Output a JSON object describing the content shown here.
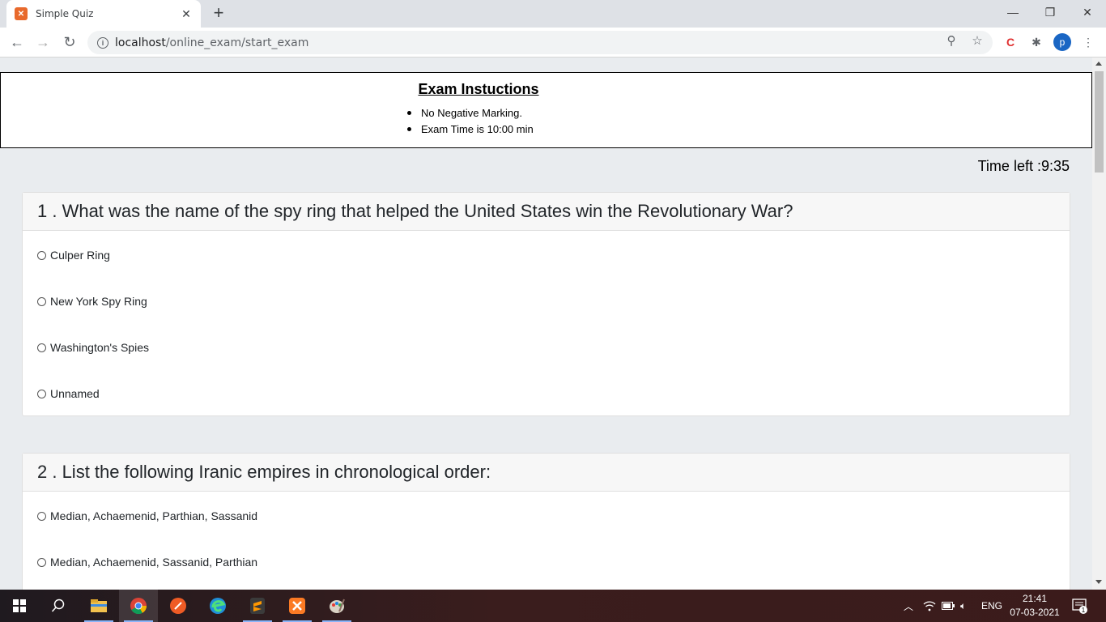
{
  "browser": {
    "tab_title": "Simple Quiz",
    "url_host": "localhost",
    "url_path": "/online_exam/start_exam",
    "avatar_letter": "p"
  },
  "instructions": {
    "heading": "Exam Instuctions",
    "items": [
      "No Negative Marking.",
      "Exam Time is 10:00 min"
    ]
  },
  "timer": "Time left :9:35",
  "questions": [
    {
      "header": "1 . What was the name of the spy ring that helped the United States win the Revolutionary War?",
      "options": [
        "Culper Ring",
        "New York Spy Ring",
        "Washington's Spies",
        "Unnamed"
      ]
    },
    {
      "header": "2 . List the following Iranic empires in chronological order:",
      "options": [
        "Median, Achaemenid, Parthian, Sassanid",
        "Median, Achaemenid, Sassanid, Parthian"
      ]
    }
  ],
  "taskbar": {
    "language": "ENG",
    "time": "21:41",
    "date": "07-03-2021",
    "notification_count": "1"
  },
  "colors": {
    "page_bg": "#e9ecef",
    "accent_orange": "#e8692c",
    "avatar_blue": "#1a66c4"
  }
}
